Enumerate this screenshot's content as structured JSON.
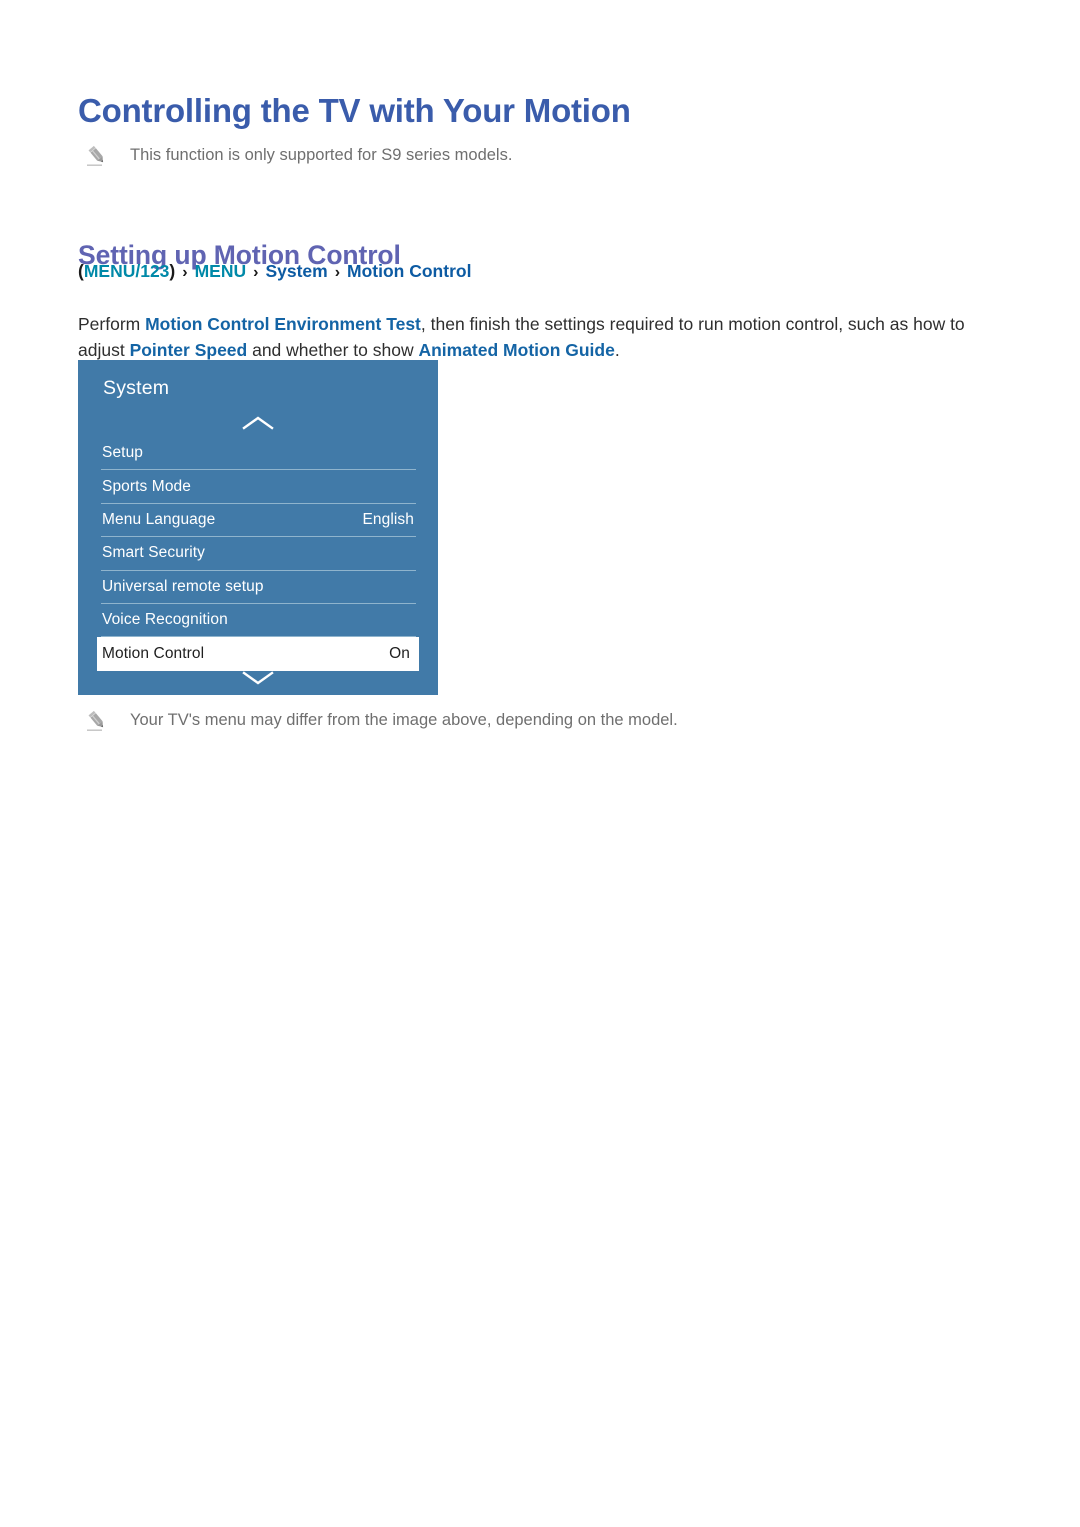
{
  "document": {
    "title": "Controlling the TV with Your Motion",
    "top_note": {
      "icon": "pencil-icon",
      "text": "This function is only supported for S9 series models."
    },
    "section": {
      "heading": "Setting up Motion Control",
      "breadcrumb": {
        "open_paren": "(",
        "close_paren": ")",
        "separator": "›",
        "items": [
          {
            "label": "MENU/123",
            "color_role": "teal"
          },
          {
            "label": "MENU",
            "color_role": "teal"
          },
          {
            "label": "System",
            "color_role": "blue"
          },
          {
            "label": "Motion Control",
            "color_role": "blue"
          }
        ]
      },
      "paragraph": {
        "segment_1": "Perform ",
        "highlight_1": "Motion Control Environment Test",
        "segment_2": ", then finish the settings required to run motion control, such as how to adjust ",
        "highlight_2": "Pointer Speed",
        "segment_3": " and whether to show ",
        "highlight_3": "Animated Motion Guide",
        "segment_4": "."
      }
    },
    "tv_menu": {
      "title": "System",
      "scroll_up_icon": "chevron-up-icon",
      "scroll_down_icon": "chevron-down-icon",
      "rows": [
        {
          "label": "Setup",
          "value": "",
          "selected": false
        },
        {
          "label": "Sports Mode",
          "value": "",
          "selected": false
        },
        {
          "label": "Menu Language",
          "value": "English",
          "selected": false
        },
        {
          "label": "Smart Security",
          "value": "",
          "selected": false
        },
        {
          "label": "Universal remote setup",
          "value": "",
          "selected": false
        },
        {
          "label": "Voice Recognition",
          "value": "",
          "selected": false
        },
        {
          "label": "Motion Control",
          "value": "On",
          "selected": true
        }
      ]
    },
    "bottom_note": {
      "icon": "pencil-icon",
      "text": "Your TV's menu may differ from the image above, depending on the model."
    },
    "colors": {
      "title_blue": "#3a5cab",
      "section_purple": "#6064b2",
      "breadcrumb_teal": "#0089a8",
      "breadcrumb_blue": "#0d5ba3",
      "highlight_blue": "#1464a5",
      "panel_background": "#417aa8",
      "note_gray": "#6f6f6f",
      "selected_row_background": "#ffffff"
    }
  }
}
